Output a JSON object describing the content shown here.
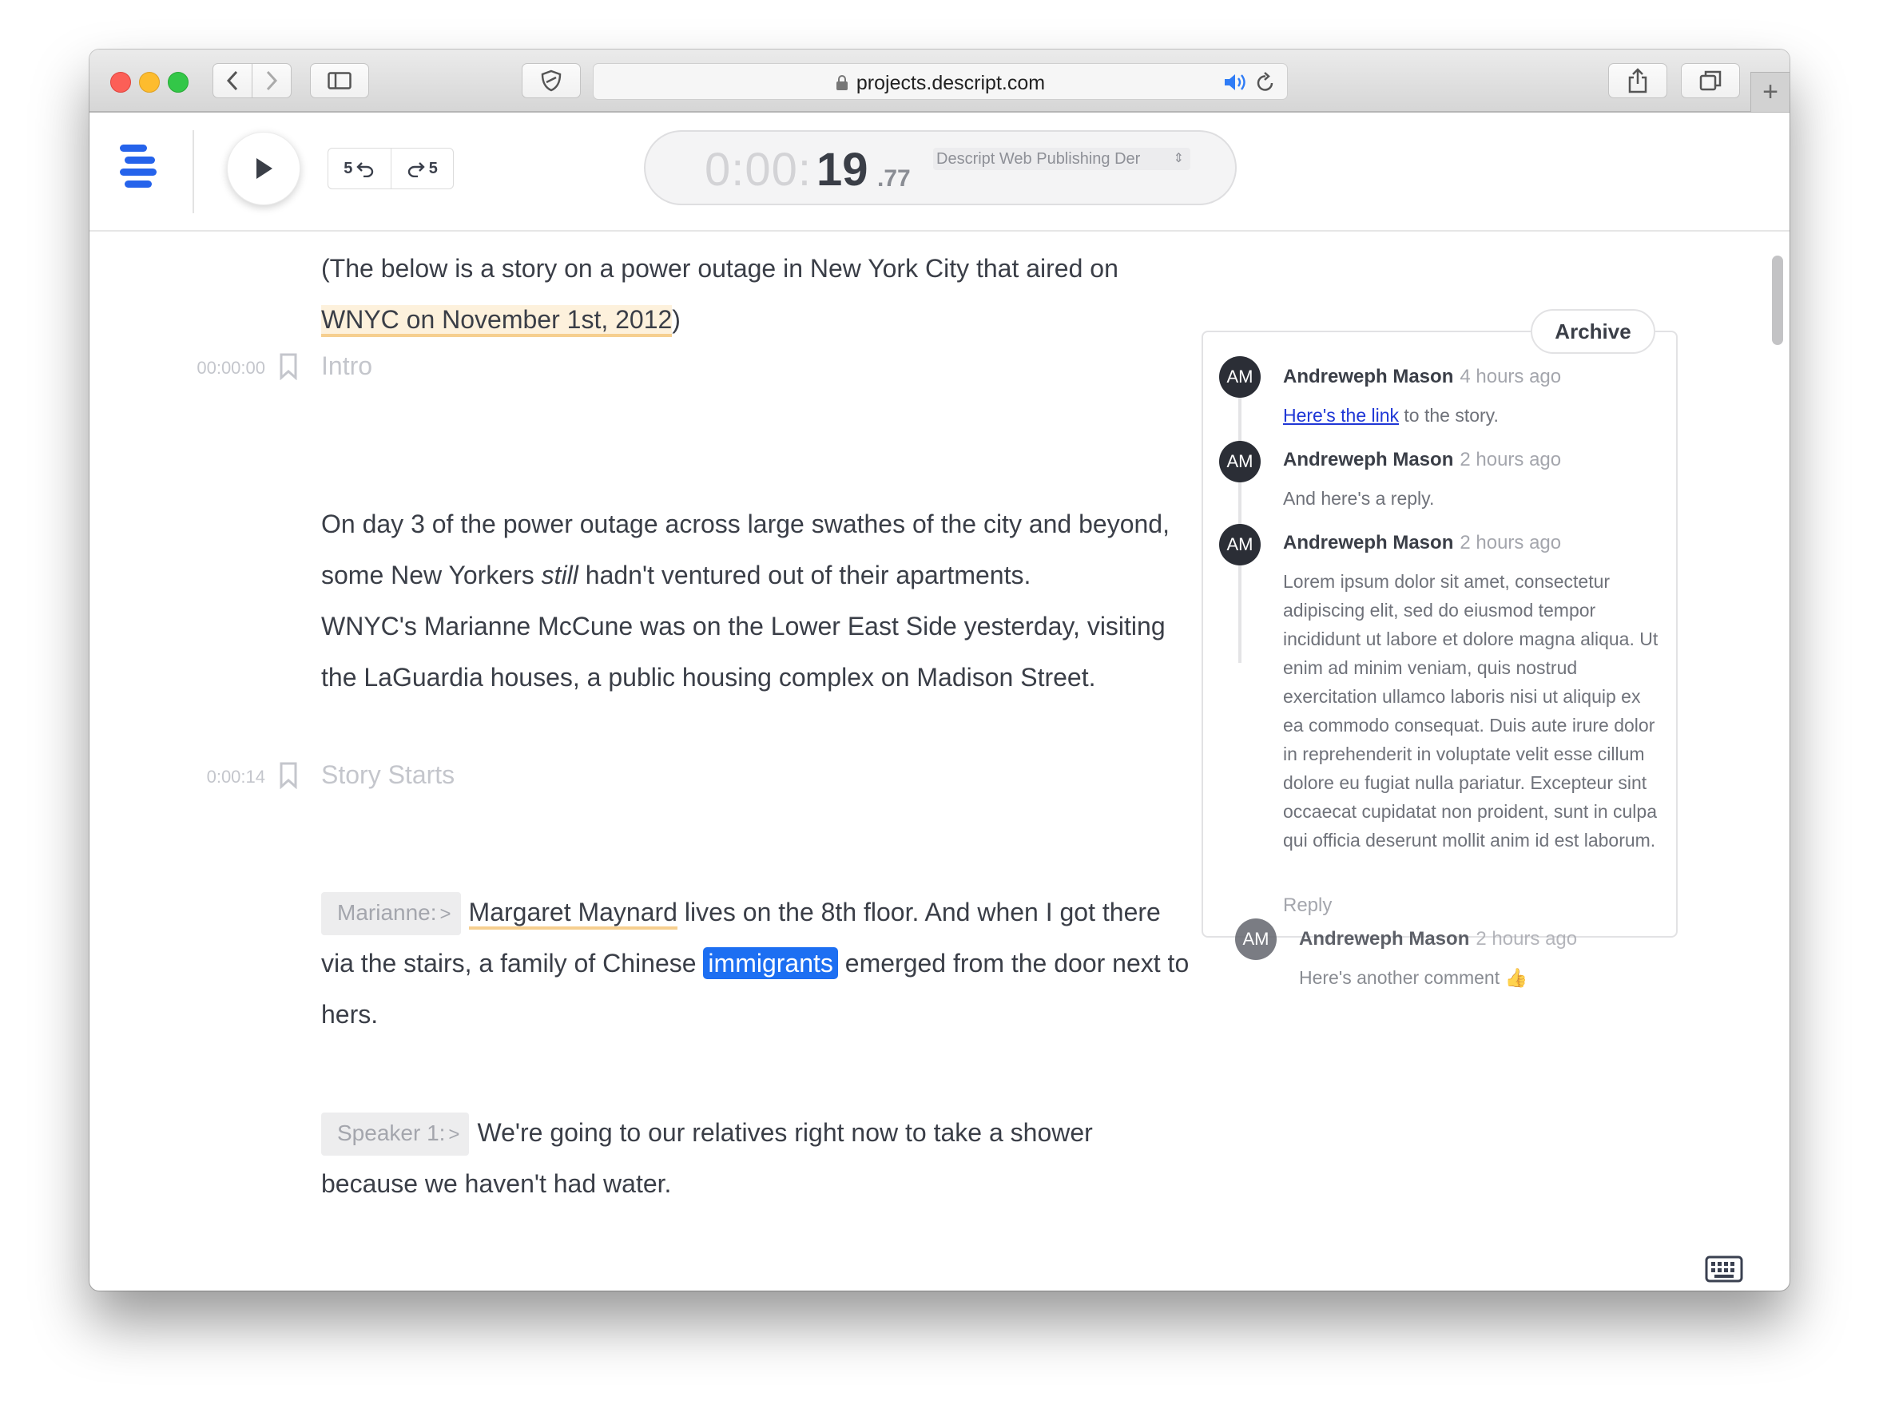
{
  "browser": {
    "url": "projects.descript.com"
  },
  "player": {
    "skip_back_label": "5",
    "skip_forward_label": "5",
    "time_dim": "0:00:",
    "time_seconds": "19",
    "time_fraction": ".77",
    "project_name": "Descript Web Publishing Der",
    "project_selector_arrows": "⇕"
  },
  "transcript": {
    "intro_para": {
      "text_before": "(The below is a story on a power outage in New York City that aired on ",
      "highlight": "WNYC on November 1st, 2012",
      "text_after": ")"
    },
    "markers": [
      {
        "time": "00:00:00",
        "label": "Intro"
      },
      {
        "time": "0:00:14",
        "label": "Story Starts"
      }
    ],
    "para1": {
      "text_before": "On day 3 of the power outage across large swathes of the city and beyond, some New Yorkers ",
      "italic": "still",
      "text_after": " hadn't ventured out of their apartments."
    },
    "para2": "WNYC's Marianne McCune was on the Lower East Side yesterday, visiting the LaGuardia houses, a public housing complex on Madison Street.",
    "para3": {
      "speaker": "Marianne:",
      "underlined": "Margaret Maynard",
      "text_mid": " lives on the 8th floor. And when I got there via the stairs, a family of Chinese",
      "selected": "immigrants",
      "text_after": "emerged from the door next to hers."
    },
    "para4": {
      "speaker": "Speaker 1:",
      "text": "We're going to our relatives right now to take a shower because we haven't had water."
    },
    "speaker_chevron": ">"
  },
  "comments": {
    "archive_label": "Archive",
    "reply_label": "Reply",
    "thread": [
      {
        "initials": "AM",
        "author": "Andreweph Mason",
        "time": "4 hours ago",
        "link_text": "Here's the link",
        "text": " to the story."
      },
      {
        "initials": "AM",
        "author": "Andreweph Mason",
        "time": "2 hours ago",
        "text": "And here's a reply."
      },
      {
        "initials": "AM",
        "author": "Andreweph Mason",
        "time": "2 hours ago",
        "text": "Lorem ipsum dolor sit amet, consectetur adipiscing elit, sed do eiusmod tempor incididunt ut labore et dolore magna aliqua. Ut enim ad minim veniam, quis nostrud exercitation ullamco laboris nisi ut aliquip ex ea commodo consequat. Duis aute irure dolor in reprehenderit in voluptate velit esse cillum dolore eu fugiat nulla pariatur. Excepteur sint occaecat cupidatat non proident, sunt in culpa qui officia deserunt mollit anim id est laborum."
      }
    ],
    "standalone": {
      "initials": "AM",
      "author": "Andreweph Mason",
      "time": "2 hours ago",
      "text": "Here's another comment",
      "emoji": "👍"
    }
  },
  "icons": {
    "keyboard": "keyboard-icon",
    "bookmark": "bookmark-icon",
    "play": "play-icon"
  },
  "colors": {
    "accent": "#1d6ff2",
    "brand": "#2563eb",
    "highlight_bg": "#fdf1dc",
    "highlight_line": "#f6cf8f"
  }
}
